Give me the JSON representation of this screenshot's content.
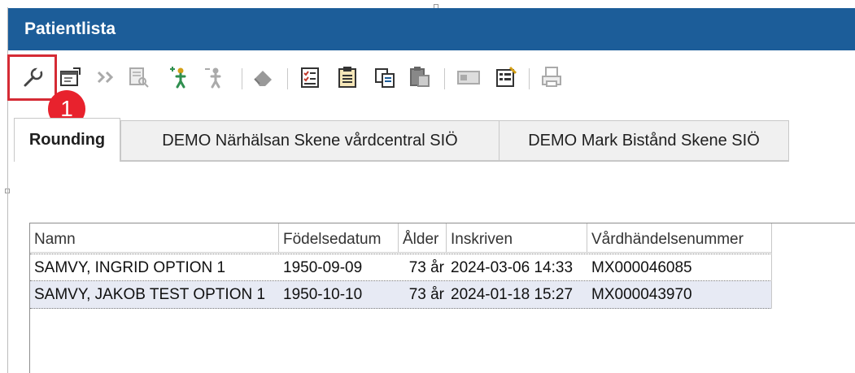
{
  "window": {
    "title": "Patientlista"
  },
  "toolbar": {
    "buttons": [
      {
        "icon": "wrench-icon",
        "name": "settings"
      },
      {
        "icon": "window-properties-icon",
        "name": "properties"
      },
      {
        "icon": "double-chevron-right-icon",
        "name": "forward"
      },
      {
        "icon": "document-search-icon",
        "name": "document-search"
      },
      {
        "icon": "person-add-icon",
        "name": "add-person"
      },
      {
        "icon": "person-remove-icon",
        "name": "remove-person"
      },
      {
        "icon": "eraser-icon",
        "name": "eraser"
      },
      {
        "icon": "checklist-icon",
        "name": "checklist"
      },
      {
        "icon": "clipboard-icon",
        "name": "clipboard"
      },
      {
        "icon": "clipboard-copy-icon",
        "name": "copy"
      },
      {
        "icon": "clipboard-paste-icon",
        "name": "paste"
      },
      {
        "icon": "card-icon",
        "name": "card"
      },
      {
        "icon": "form-edit-icon",
        "name": "form-edit"
      },
      {
        "icon": "print-icon",
        "name": "print"
      }
    ]
  },
  "annotation": {
    "step_number": "1",
    "color": "#e8222d"
  },
  "tabs": [
    {
      "label": "Rounding",
      "active": true
    },
    {
      "label": "DEMO Närhälsan Skene vårdcentral SIÖ",
      "active": false
    },
    {
      "label": "DEMO Mark Bistånd Skene SIÖ",
      "active": false
    }
  ],
  "table": {
    "columns": [
      "Namn",
      "Födelsedatum",
      "Ålder",
      "Inskriven",
      "Vårdhändelsenummer"
    ],
    "rows": [
      [
        "SAMVY, INGRID OPTION 1",
        "1950-09-09",
        "73 år",
        "2024-03-06 14:33",
        "MX000046085"
      ],
      [
        "SAMVY, JAKOB TEST OPTION 1",
        "1950-10-10",
        "73 år",
        "2024-01-18 15:27",
        "MX000043970"
      ]
    ]
  },
  "colors": {
    "titlebar": "#1c5d99",
    "selected_row": "#e7eaf4"
  }
}
